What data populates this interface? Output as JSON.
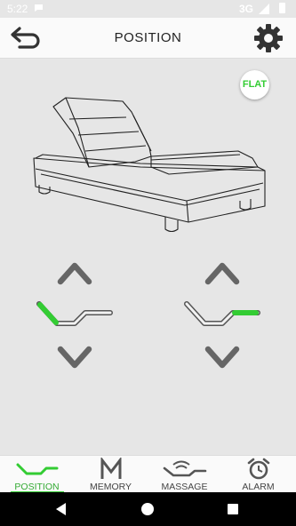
{
  "status": {
    "time": "5:22",
    "network": "3G"
  },
  "header": {
    "title": "POSITION",
    "back_icon": "back-arrow-icon",
    "settings_icon": "gear-icon"
  },
  "flat_button": {
    "label": "FLAT"
  },
  "colors": {
    "accent": "#33cc33",
    "icon_gray": "#666666",
    "background": "#e6e6e6"
  },
  "controls": {
    "head": {
      "up_icon": "chevron-up-icon",
      "down_icon": "chevron-down-icon",
      "section_icon": "bed-head-section-icon"
    },
    "foot": {
      "up_icon": "chevron-up-icon",
      "down_icon": "chevron-down-icon",
      "section_icon": "bed-foot-section-icon"
    }
  },
  "bottom_nav": {
    "items": [
      {
        "label": "POSITION",
        "icon": "position-icon",
        "active": true
      },
      {
        "label": "MEMORY",
        "icon": "memory-m-icon",
        "active": false
      },
      {
        "label": "MASSAGE",
        "icon": "massage-icon",
        "active": false
      },
      {
        "label": "ALARM",
        "icon": "alarm-clock-icon",
        "active": false
      }
    ]
  }
}
